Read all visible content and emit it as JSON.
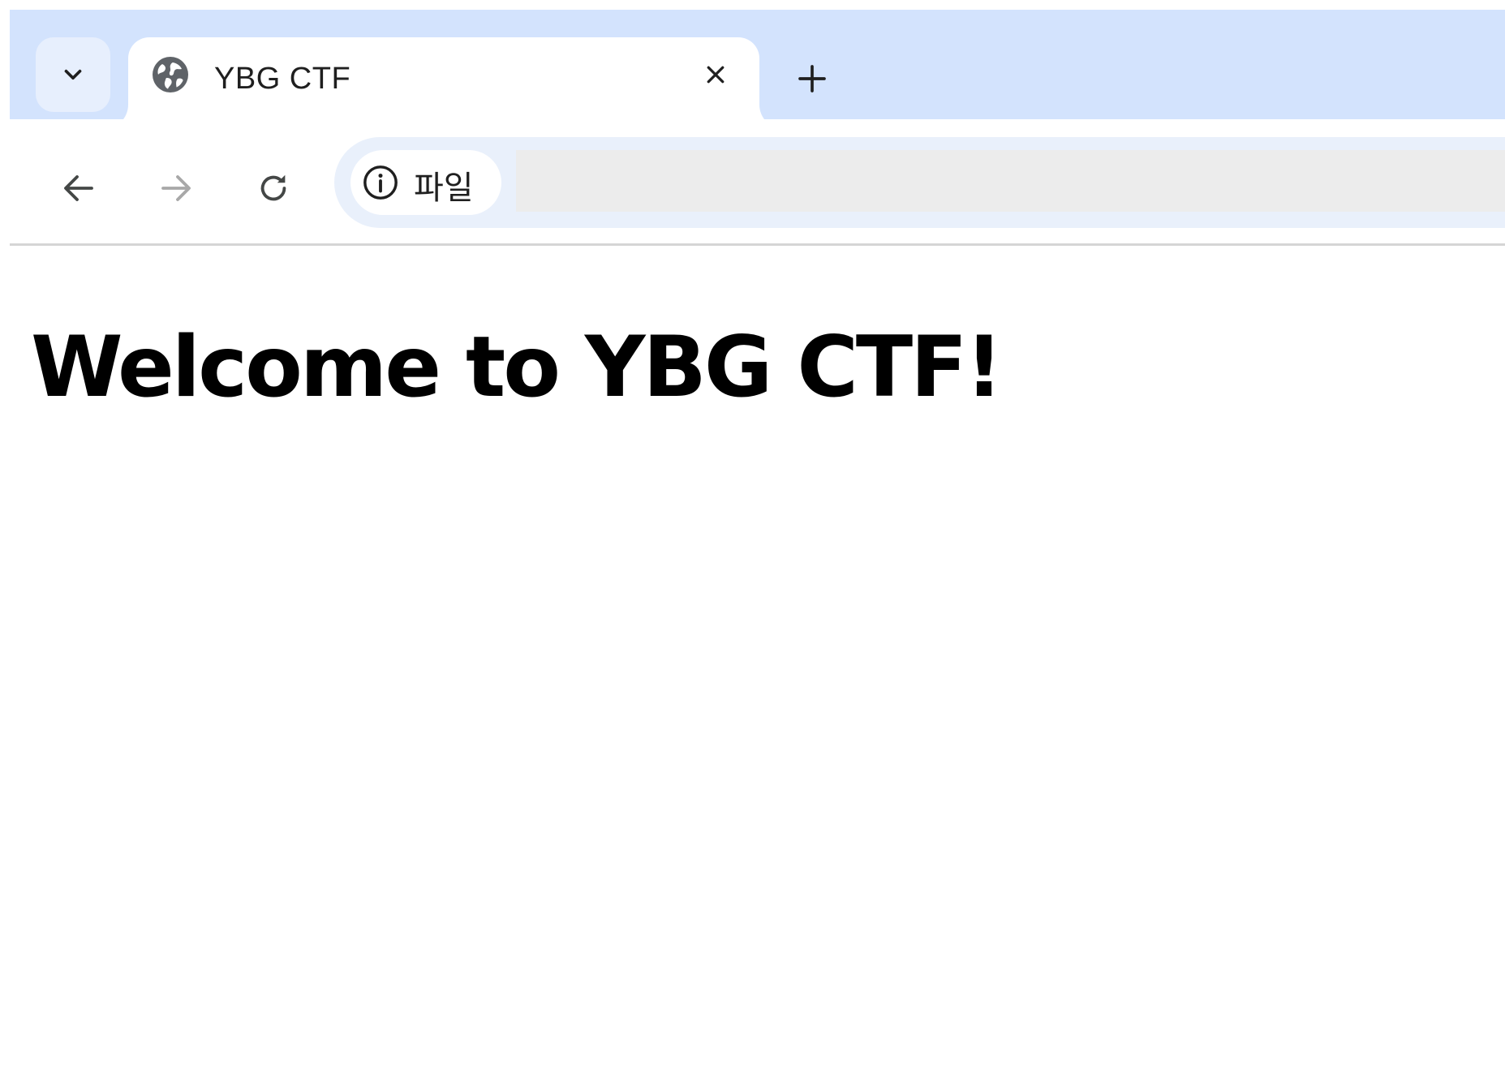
{
  "browser": {
    "tab": {
      "title": "YBG CTF",
      "favicon": "globe-icon"
    },
    "toolbar": {
      "back_icon": "arrow-left-icon",
      "forward_icon": "arrow-right-icon",
      "reload_icon": "reload-icon",
      "site_info_icon": "info-icon",
      "site_info_label": "파일",
      "url_value": ""
    },
    "colors": {
      "tabstrip_bg": "#d3e3fd",
      "omnibox_bg": "#e9f0fb",
      "icon_color": "#444746",
      "disabled_icon_color": "#a8a8a8"
    }
  },
  "page": {
    "heading": "Welcome to YBG CTF!"
  }
}
